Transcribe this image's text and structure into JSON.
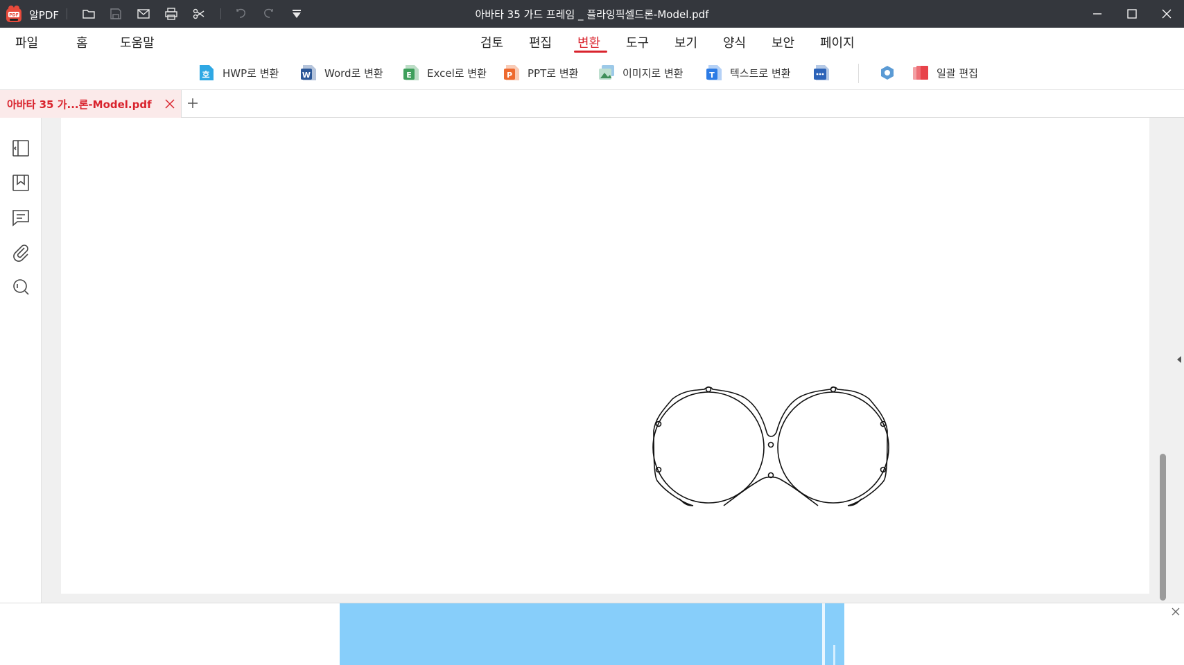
{
  "app": {
    "name": "알PDF",
    "document_title": "아바타 35 가드 프레임 _ 플라잉픽셀드론-Model.pdf",
    "quick_access": [
      "open-folder-icon",
      "save-icon",
      "mail-icon",
      "print-icon",
      "scissors-icon",
      "undo-icon",
      "redo-icon",
      "customize-dropdown-icon"
    ],
    "window_controls": [
      "minimize-icon",
      "maximize-icon",
      "close-icon"
    ]
  },
  "menu": {
    "left": [
      {
        "label": "파일"
      },
      {
        "label": "홈"
      },
      {
        "label": "도움말"
      }
    ],
    "center": [
      {
        "label": "검토"
      },
      {
        "label": "편집"
      },
      {
        "label": "변환",
        "active": true
      },
      {
        "label": "도구"
      },
      {
        "label": "보기"
      },
      {
        "label": "양식"
      },
      {
        "label": "보안"
      },
      {
        "label": "페이지"
      }
    ]
  },
  "ribbon": {
    "buttons": [
      {
        "label": "HWP로 변환",
        "icon": "hwp-icon",
        "color": "#2fa8e4"
      },
      {
        "label": "Word로 변환",
        "icon": "word-icon",
        "color": "#2b5797"
      },
      {
        "label": "Excel로 변환",
        "icon": "excel-icon",
        "color": "#3e9f5b"
      },
      {
        "label": "PPT로 변환",
        "icon": "ppt-icon",
        "color": "#ee6a2f"
      },
      {
        "label": "이미지로 변환",
        "icon": "image-icon",
        "color": "#5aaa74"
      },
      {
        "label": "텍스트로 변환",
        "icon": "text-icon",
        "color": "#2c7be5"
      },
      {
        "label": "",
        "icon": "more-icon",
        "color": "#2c63b8"
      }
    ],
    "extra": [
      {
        "label": "",
        "icon": "hexagon-settings-icon",
        "color": "#5b9bd5"
      },
      {
        "label": "일괄 편집",
        "icon": "batch-edit-icon",
        "color": "#e8434a"
      }
    ]
  },
  "tabs": {
    "active_tab_label": "아바타 35 가...론-Model.pdf"
  },
  "sidebar": {
    "items": [
      "panel-toggle-icon",
      "bookmark-icon",
      "comment-icon",
      "attachment-icon",
      "search-icon"
    ]
  },
  "colors": {
    "accent": "#d9232d",
    "titlebar": "#34373d",
    "ad_banner": "#87cefa"
  }
}
